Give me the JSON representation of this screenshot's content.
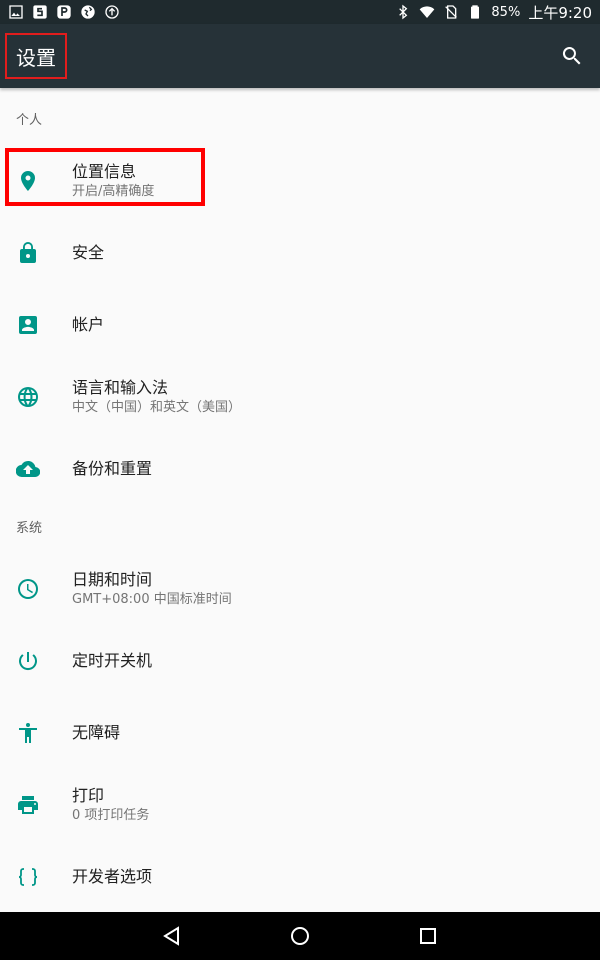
{
  "status_bar": {
    "icons_left": [
      "image-icon",
      "s-app-icon",
      "p-app-icon",
      "globe-app-icon",
      "upload-icon"
    ],
    "battery": "85%",
    "time": "上午9:20"
  },
  "app_bar": {
    "title": "设置",
    "search_icon": "search-icon"
  },
  "sections": [
    {
      "header": "个人",
      "items": [
        {
          "title": "位置信息",
          "summary": "开启/高精确度",
          "icon": "location-icon"
        },
        {
          "title": "安全",
          "summary": "",
          "icon": "lock-icon"
        },
        {
          "title": "帐户",
          "summary": "",
          "icon": "account-icon"
        },
        {
          "title": "语言和输入法",
          "summary": "中文（中国）和英文（美国）",
          "icon": "globe-icon"
        },
        {
          "title": "备份和重置",
          "summary": "",
          "icon": "cloud-upload-icon"
        }
      ]
    },
    {
      "header": "系统",
      "items": [
        {
          "title": "日期和时间",
          "summary": "GMT+08:00 中国标准时间",
          "icon": "clock-icon"
        },
        {
          "title": "定时开关机",
          "summary": "",
          "icon": "power-icon"
        },
        {
          "title": "无障碍",
          "summary": "",
          "icon": "accessibility-icon"
        },
        {
          "title": "打印",
          "summary": "0 项打印任务",
          "icon": "print-icon"
        },
        {
          "title": "开发者选项",
          "summary": "",
          "icon": "braces-icon"
        }
      ]
    }
  ],
  "colors": {
    "accent": "#009688",
    "app_bar": "#263238",
    "status_bar": "#1f2a2e",
    "highlight": "#ff0000"
  },
  "nav_bar": {
    "icons": [
      "back-icon",
      "home-icon",
      "recents-icon"
    ]
  }
}
